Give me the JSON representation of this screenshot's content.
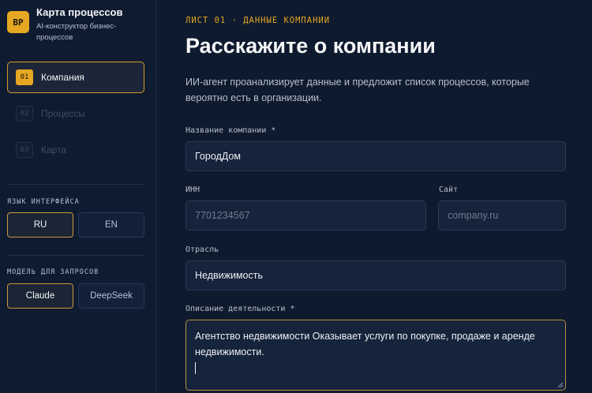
{
  "brand": {
    "logo": "BP",
    "title": "Карта процессов",
    "subtitle": "AI-конструктор бизнес-процессов"
  },
  "nav": {
    "items": [
      {
        "num": "01",
        "label": "Компания",
        "active": true
      },
      {
        "num": "02",
        "label": "Процессы",
        "active": false
      },
      {
        "num": "03",
        "label": "Карта",
        "active": false
      }
    ]
  },
  "language": {
    "label": "ЯЗЫК ИНТЕРФЕЙСА",
    "options": [
      "RU",
      "EN"
    ],
    "selected": "RU"
  },
  "model": {
    "label": "МОДЕЛЬ ДЛЯ ЗАПРОСОВ",
    "options": [
      "Claude",
      "DeepSeek"
    ],
    "selected": "Claude"
  },
  "main": {
    "kicker": "ЛИСТ 01 · ДАННЫЕ КОМПАНИИ",
    "title": "Расскажите о компании",
    "description": "ИИ-агент проанализирует данные и предложит список процессов, которые вероятно есть в организации.",
    "fields": {
      "company_name": {
        "label": "Название компании *",
        "value": "ГородДом"
      },
      "inn": {
        "label": "ИНН",
        "placeholder": "7701234567"
      },
      "site": {
        "label": "Сайт",
        "placeholder": "company.ru"
      },
      "industry": {
        "label": "Отрасль",
        "value": "Недвижимость"
      },
      "activity": {
        "label": "Описание деятельности *",
        "value": "Агентство недвижимости Оказывает услуги по покупке, продаже и аренде недвижимости."
      }
    }
  },
  "colors": {
    "accent": "#e6a723",
    "background": "#0e1a2e",
    "sidebar": "#0f1b30",
    "field": "#15233b"
  }
}
